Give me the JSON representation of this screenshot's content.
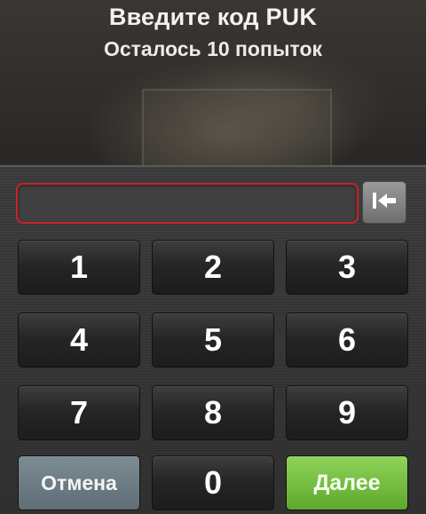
{
  "header": {
    "title": "Введите код PUK",
    "subtitle": "Осталось 10 попыток"
  },
  "input": {
    "value": "",
    "border_color": "#c8232a"
  },
  "backspace": {
    "icon": "backspace-icon"
  },
  "keys": {
    "k1": "1",
    "k2": "2",
    "k3": "3",
    "k4": "4",
    "k5": "5",
    "k6": "6",
    "k7": "7",
    "k8": "8",
    "k9": "9",
    "k0": "0",
    "cancel": "Отмена",
    "ok": "Далее"
  },
  "colors": {
    "ok_button": "#6cbd35",
    "cancel_button": "#6e7c84",
    "key_background": "#262626"
  }
}
